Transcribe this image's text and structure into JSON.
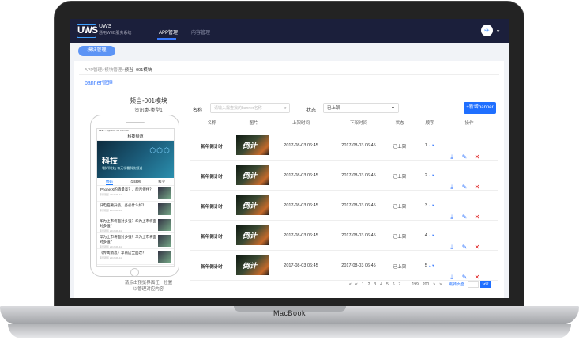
{
  "brand": "MacBook",
  "header": {
    "logo": "UWS",
    "logo_text": "UWS",
    "logo_sub": "通用WEB服务系统",
    "nav": [
      "APP管理",
      "内容管理"
    ],
    "avatar_icon": "bird-logo-icon"
  },
  "module_button": "模块管理",
  "breadcrumb": {
    "path": "APP管理>模块管理>",
    "current": "频当--001模块"
  },
  "left": {
    "title": "banner管理",
    "item_name": "频当-001模块",
    "item_type": "资讯类-类型1",
    "hint1": "请点击预览界面任一位置",
    "hint2": "以管理对应内容"
  },
  "phone": {
    "status": "●●●○○ AppSum 4G 9:41 AM",
    "header": "科技频道",
    "banner_title": "科技",
    "banner_sub": "看好科技 | 每天学看科技频道",
    "tabs": [
      "数码",
      "互联网",
      "科学"
    ],
    "news": [
      {
        "title": "iPhone X的销量高？，能否保住？",
        "meta": "专家观点 2017-08-11"
      },
      {
        "title": "旧电脑要升级，务必什么好？",
        "meta": "专家观点 2017-08-11"
      },
      {
        "title": "华为上市将面对多强？华为上市将面对多强？",
        "meta": "专家观点 2017-08-11"
      },
      {
        "title": "华为上市将面对多强？华为上市将面对多强？",
        "meta": "专家观点 2017-08-11"
      },
      {
        "title": "《传闻消息》苹商店全面改？",
        "meta": "专家观点 2017-08-11"
      }
    ]
  },
  "filters": {
    "name_label": "名称",
    "search_placeholder": "请输入需查找的banner名称",
    "status_label": "状态",
    "status_value": "已上架",
    "add_button": "+新增banner"
  },
  "table": {
    "headers": [
      "名称",
      "图片",
      "上架时间",
      "下架时间",
      "状态",
      "顺序",
      "操作"
    ],
    "rows": [
      {
        "name": "新年倒计时",
        "on": "2017-08-03 06:45",
        "off": "2017-08-03 06:45",
        "status": "已上架",
        "order": "1"
      },
      {
        "name": "新年倒计时",
        "on": "2017-08-03 06:45",
        "off": "2017-08-03 06:45",
        "status": "已上架",
        "order": "2"
      },
      {
        "name": "新年倒计时",
        "on": "2017-08-03 06:45",
        "off": "2017-08-03 06:45",
        "status": "已上架",
        "order": "3"
      },
      {
        "name": "新年倒计时",
        "on": "2017-08-03 06:45",
        "off": "2017-08-03 06:45",
        "status": "已上架",
        "order": "4"
      },
      {
        "name": "新年倒计时",
        "on": "2017-08-03 06:45",
        "off": "2017-08-03 06:45",
        "status": "已上架",
        "order": "5"
      }
    ]
  },
  "pager": {
    "pages": [
      "<",
      "<",
      "1",
      "2",
      "3",
      "4",
      "5",
      "6",
      "7",
      "...",
      "199",
      "200",
      ">",
      ">"
    ],
    "goto": "跳转页面",
    "go": "GO"
  }
}
